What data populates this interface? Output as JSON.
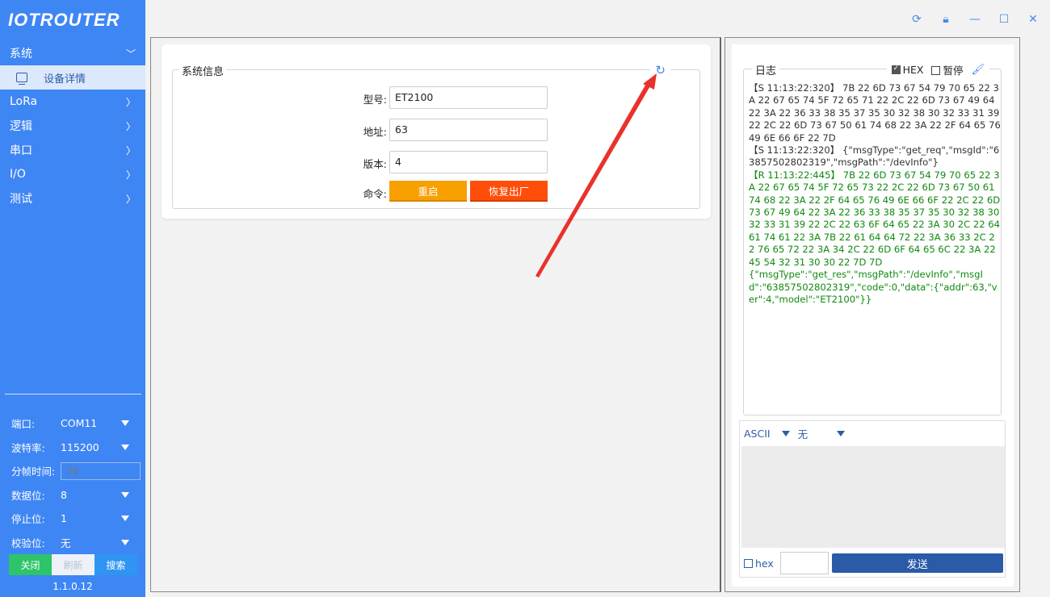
{
  "app": {
    "logo": "IOTROUTER",
    "version": "1.1.0.12"
  },
  "nav": {
    "items": [
      {
        "label": "系统",
        "expanded": true
      },
      {
        "label": "LoRa"
      },
      {
        "label": "逻辑"
      },
      {
        "label": "串口"
      },
      {
        "label": "I/O"
      },
      {
        "label": "测试"
      }
    ],
    "sub_item": "设备详情"
  },
  "serial": {
    "port_label": "端口:",
    "port": "COM11",
    "baud_label": "波特率:",
    "baud": "115200",
    "frame_label": "分帧时间:",
    "frame_placeholder": "20",
    "databits_label": "数据位:",
    "databits": "8",
    "stopbits_label": "停止位:",
    "stopbits": "1",
    "parity_label": "校验位:",
    "parity": "无",
    "close_label": "关闭",
    "refresh_label": "刷新",
    "search_label": "搜索"
  },
  "sysinfo": {
    "legend": "系统信息",
    "model_label": "型号:",
    "model": "ET2100",
    "addr_label": "地址:",
    "addr": "63",
    "ver_label": "版本:",
    "ver": "4",
    "cmd_label": "命令:",
    "restart_label": "重启",
    "factory_label": "恢复出厂"
  },
  "log": {
    "legend": "日志",
    "hex_label": "HEX",
    "hex_checked": true,
    "pause_label": "暂停",
    "pause_checked": false,
    "entries": [
      {
        "kind": "s",
        "text": "【S 11:13:22:320】 7B 22 6D 73 67 54 79 70 65 22 3A 22 67 65 74 5F 72 65 71 22 2C 22 6D 73 67 49 64 22 3A 22 36 33 38 35 37 35 30 32 38 30 32 33 31 39 22 2C 22 6D 73 67 50 61 74 68 22 3A 22 2F 64 65 76 49 6E 66 6F 22 7D"
      },
      {
        "kind": "s",
        "text": "【S 11:13:22:320】 {\"msgType\":\"get_req\",\"msgId\":\"63857502802319\",\"msgPath\":\"/devInfo\"}"
      },
      {
        "kind": "r",
        "text": "【R 11:13:22:445】 7B 22 6D 73 67 54 79 70 65 22 3A 22 67 65 74 5F 72 65 73 22 2C 22 6D 73 67 50 61 74 68 22 3A 22 2F 64 65 76 49 6E 66 6F 22 2C 22 6D 73 67 49 64 22 3A 22 36 33 38 35 37 35 30 32 38 30 32 33 31 39 22 2C 22 63 6F 64 65 22 3A 30 2C 22 64 61 74 61 22 3A 7B 22 61 64 64 72 22 3A 36 33 2C 22 76 65 72 22 3A 34 2C 22 6D 6F 64 65 6C 22 3A 22 45 54 32 31 30 30 22 7D 7D"
      },
      {
        "kind": "r",
        "text": "{\"msgType\":\"get_res\",\"msgPath\":\"/devInfo\",\"msgId\":\"63857502802319\",\"code\":0,\"data\":{\"addr\":63,\"ver\":4,\"model\":\"ET2100\"}}"
      }
    ]
  },
  "send": {
    "encoding": "ASCII",
    "suffix": "无",
    "hex_label": "hex",
    "send_label": "发送"
  },
  "colors": {
    "sidebar": "#3f86f5",
    "restart": "#f8a000",
    "factory": "#ff4e0a",
    "send": "#2a5aa8",
    "log_recv": "#108a10",
    "annotation": "#e8322b"
  }
}
